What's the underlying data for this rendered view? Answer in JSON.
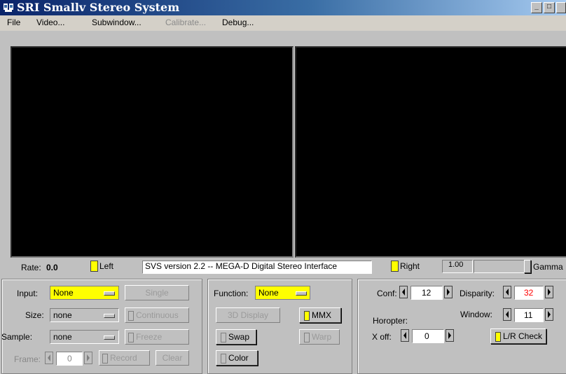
{
  "window": {
    "title": "SRI Smallv Stereo System",
    "minimize_glyph": "_",
    "maximize_glyph": "□"
  },
  "menu": {
    "items": [
      {
        "label": "File",
        "enabled": true
      },
      {
        "label": "Video...",
        "enabled": true
      },
      {
        "label": "Subwindow...",
        "enabled": true
      },
      {
        "label": "Calibrate...",
        "enabled": false
      },
      {
        "label": "Debug...",
        "enabled": true
      }
    ]
  },
  "status": {
    "rate_label": "Rate:",
    "rate_value": "0.0",
    "left_label": "Left",
    "message": "SVS version 2.2 -- MEGA-D Digital Stereo Interface",
    "right_label": "Right",
    "gamma_value": "1.00",
    "gamma_label": "Gamma"
  },
  "left_panel": {
    "input_label": "Input:",
    "input_value": "None",
    "size_label": "Size:",
    "size_value": "none",
    "sample_label": "Sample:",
    "sample_value": "none",
    "frame_label": "Frame:",
    "frame_value": "0",
    "single_label": "Single",
    "continuous_label": "Continuous",
    "freeze_label": "Freeze",
    "record_label": "Record",
    "clear_label": "Clear"
  },
  "middle_panel": {
    "function_label": "Function:",
    "function_value": "None",
    "display3d_label": "3D Display",
    "mmx_label": "MMX",
    "swap_label": "Swap",
    "warp_label": "Warp",
    "color_label": "Color"
  },
  "right_panel": {
    "conf_label": "Conf:",
    "conf_value": "12",
    "disparity_label": "Disparity:",
    "disparity_value": "32",
    "window_label": "Window:",
    "window_value": "11",
    "horopter_label": "Horopter:",
    "xoff_label": "X off:",
    "xoff_value": "0",
    "lr_check_label": "L/R Check"
  },
  "colors": {
    "accent_yellow": "#ffff00",
    "disparity_red": "#ff0000",
    "title_blue": "#0a246a"
  }
}
